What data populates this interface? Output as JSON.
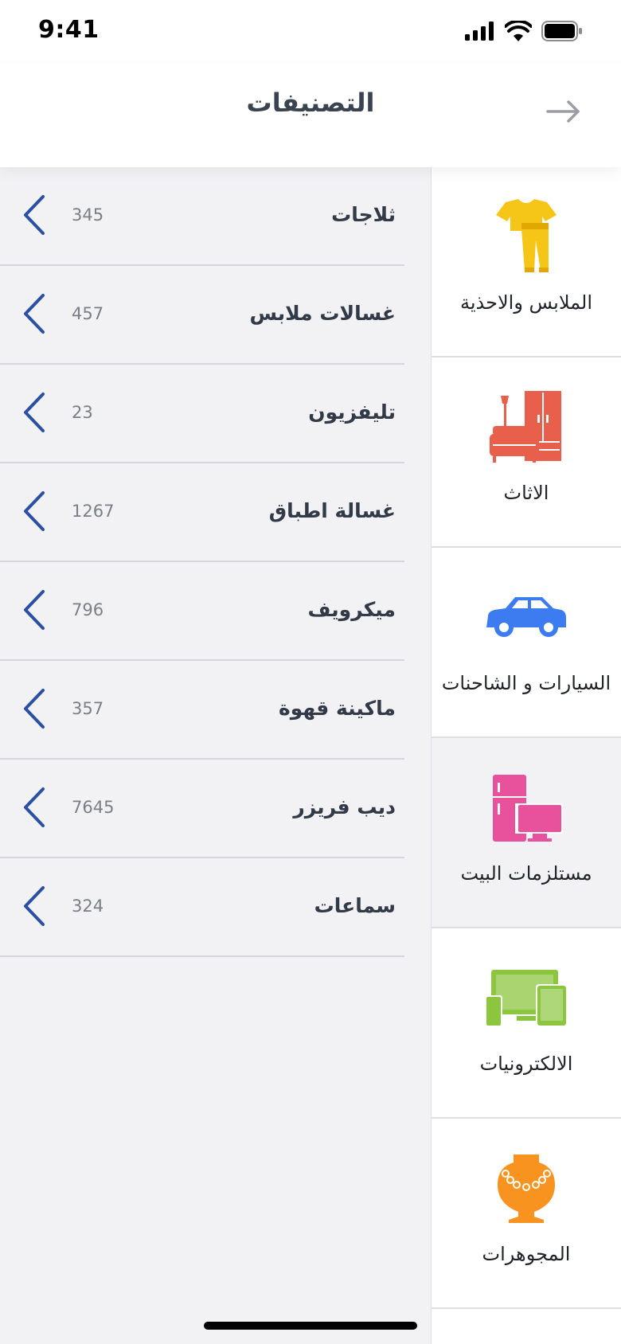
{
  "status_bar": {
    "time": "9:41"
  },
  "header": {
    "title": "التصنيفات",
    "back_icon": "arrow-right-icon"
  },
  "categories": [
    {
      "label": "الملابس والاحذية",
      "icon": "clothing-icon",
      "color": "#f5c518"
    },
    {
      "label": "الاثاث",
      "icon": "furniture-icon",
      "color": "#e8604c"
    },
    {
      "label": "السيارات و الشاحنات",
      "icon": "car-icon",
      "color": "#3d7cf0"
    },
    {
      "label": "مستلزمات البيت",
      "icon": "appliances-icon",
      "color": "#e8529c",
      "active": true
    },
    {
      "label": "الالكترونيات",
      "icon": "devices-icon",
      "color": "#8cc63f"
    },
    {
      "label": "المجوهرات",
      "icon": "jewelry-icon",
      "color": "#f7931e"
    }
  ],
  "subcategories": [
    {
      "label": "ثلاجات",
      "count": "345"
    },
    {
      "label": "غسالات ملابس",
      "count": "457"
    },
    {
      "label": "تليفزيون",
      "count": "23"
    },
    {
      "label": "غسالة اطباق",
      "count": "1267"
    },
    {
      "label": "ميكرويف",
      "count": "796"
    },
    {
      "label": "ماكينة قهوة",
      "count": "357"
    },
    {
      "label": "ديب فريزر",
      "count": "7645"
    },
    {
      "label": "سماعات",
      "count": "324"
    }
  ],
  "colors": {
    "accent": "#2b4fa3",
    "background": "#f2f2f5"
  }
}
